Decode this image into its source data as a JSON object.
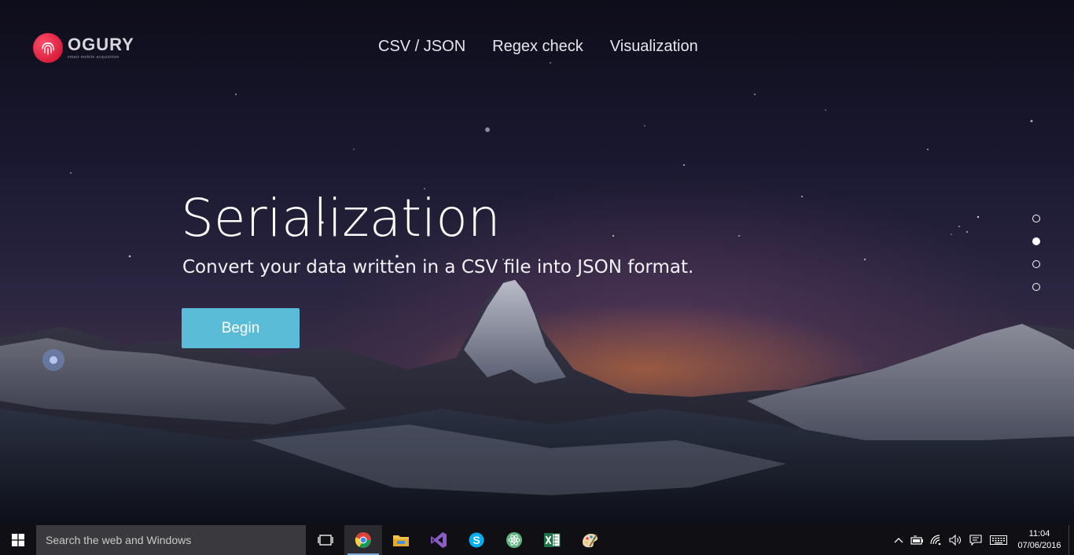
{
  "brand": {
    "name": "OGURY",
    "tagline": "smart mobile acquisition"
  },
  "nav": {
    "items": [
      {
        "label": "CSV / JSON"
      },
      {
        "label": "Regex check"
      },
      {
        "label": "Visualization"
      }
    ]
  },
  "hero": {
    "title": "Serialization",
    "subtitle": "Convert your data written in a CSV file into JSON format.",
    "button_label": "Begin"
  },
  "pager": {
    "count": 4,
    "active_index": 1
  },
  "taskbar": {
    "search_placeholder": "Search the web and Windows",
    "apps": [
      {
        "icon": "task-view-icon"
      },
      {
        "icon": "chrome-icon"
      },
      {
        "icon": "file-explorer-icon"
      },
      {
        "icon": "visual-studio-icon"
      },
      {
        "icon": "skype-icon"
      },
      {
        "icon": "atom-icon"
      },
      {
        "icon": "excel-icon"
      },
      {
        "icon": "paint-icon"
      }
    ],
    "clock": {
      "time": "11:04",
      "date": "07/06/2016"
    }
  },
  "colors": {
    "accent_button": "#5bbcd8",
    "logo_red": "#e02a46",
    "taskbar": "#101014"
  }
}
